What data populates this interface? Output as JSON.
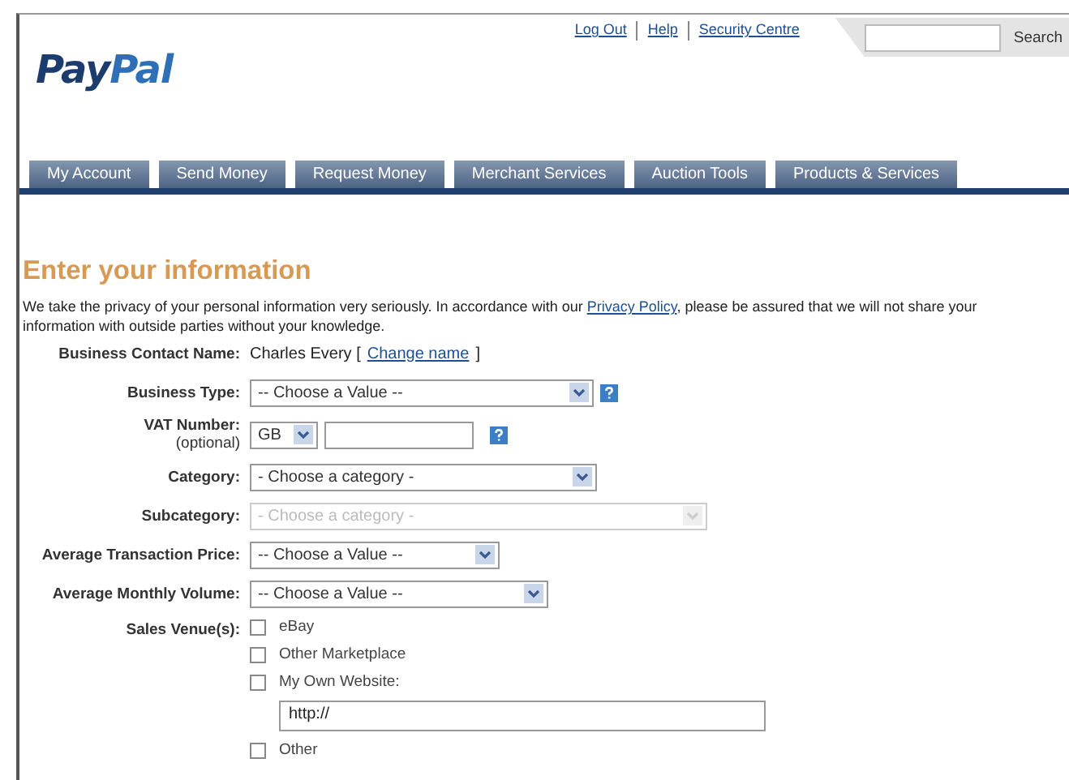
{
  "header": {
    "logo": "PayPal",
    "links": [
      "Log Out",
      "Help",
      "Security Centre"
    ],
    "search": {
      "button": "Search"
    }
  },
  "nav": {
    "tabs": [
      "My Account",
      "Send Money",
      "Request Money",
      "Merchant Services",
      "Auction Tools",
      "Products & Services"
    ]
  },
  "heading": "Enter your information",
  "intro": {
    "before": "We take the privacy of your personal information very seriously. In accordance with our",
    "link": "Privacy Policy",
    "after": ", please be assured that we will not share your information with outside parties without your knowledge."
  },
  "form": {
    "rows": [
      {
        "kind": "text",
        "label": "Business Contact Name:",
        "value": "Charles Every [",
        "link": "Change name",
        "after": "]"
      },
      {
        "kind": "select",
        "label": "Business Type:",
        "value": "-- Choose a Value --",
        "disabled": false,
        "help": true
      },
      {
        "kind": "vat",
        "label": "VAT Number:",
        "sublabel": "(optional)",
        "country": "GB",
        "value": "",
        "help": true
      },
      {
        "kind": "select",
        "label": "Category:",
        "value": "- Choose a category -",
        "disabled": false,
        "help": false
      },
      {
        "kind": "select",
        "label": "Subcategory:",
        "value": "- Choose a category -",
        "disabled": true,
        "help": false
      },
      {
        "kind": "select",
        "label": "Average Transaction Price:",
        "value": "-- Choose a Value --",
        "disabled": false,
        "help": false
      },
      {
        "kind": "select",
        "label": "Average Monthly Volume:",
        "value": "-- Choose a Value --",
        "disabled": false,
        "help": false
      },
      {
        "kind": "checks",
        "label": "Sales Venue(s):",
        "options": [
          {
            "kind": "checkbox",
            "label": "eBay",
            "checked": false
          },
          {
            "kind": "checkbox",
            "label": "Other Marketplace",
            "checked": false
          },
          {
            "kind": "url",
            "label": "My Own Website:",
            "checked": false,
            "value": "http://"
          },
          {
            "kind": "checkbox",
            "label": "Other",
            "checked": false
          }
        ]
      }
    ]
  }
}
